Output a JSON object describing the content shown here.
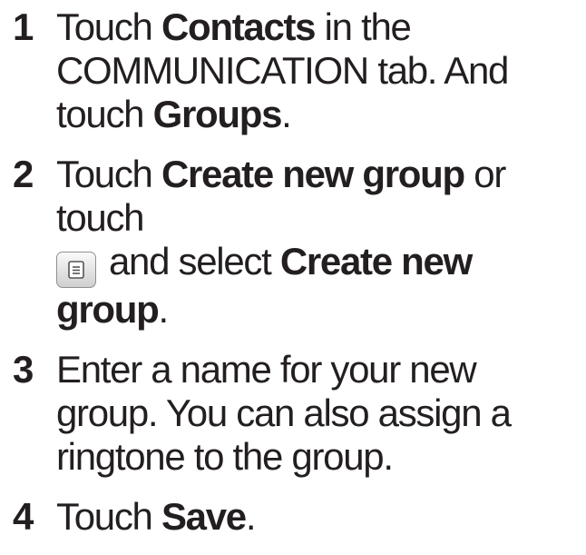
{
  "steps": [
    {
      "number": "1",
      "parts": [
        {
          "text": "Touch ",
          "bold": false
        },
        {
          "text": "Contacts",
          "bold": true
        },
        {
          "text": " in the COMMUNICATION tab. And touch ",
          "bold": false
        },
        {
          "text": "Groups",
          "bold": true
        },
        {
          "text": ".",
          "bold": false
        }
      ]
    },
    {
      "number": "2",
      "parts": [
        {
          "text": "Touch ",
          "bold": false
        },
        {
          "text": "Create new group",
          "bold": true
        },
        {
          "text": " or touch",
          "bold": false
        },
        {
          "icon": "menu-key-icon"
        },
        {
          "text": "and select ",
          "bold": false
        },
        {
          "text": "Create new group",
          "bold": true
        },
        {
          "text": ".",
          "bold": false
        }
      ]
    },
    {
      "number": "3",
      "parts": [
        {
          "text": "Enter a name for your new group. You can also assign a ringtone to the group.",
          "bold": false
        }
      ]
    },
    {
      "number": "4",
      "parts": [
        {
          "text": "Touch ",
          "bold": false
        },
        {
          "text": "Save",
          "bold": true
        },
        {
          "text": ".",
          "bold": false
        }
      ]
    }
  ]
}
